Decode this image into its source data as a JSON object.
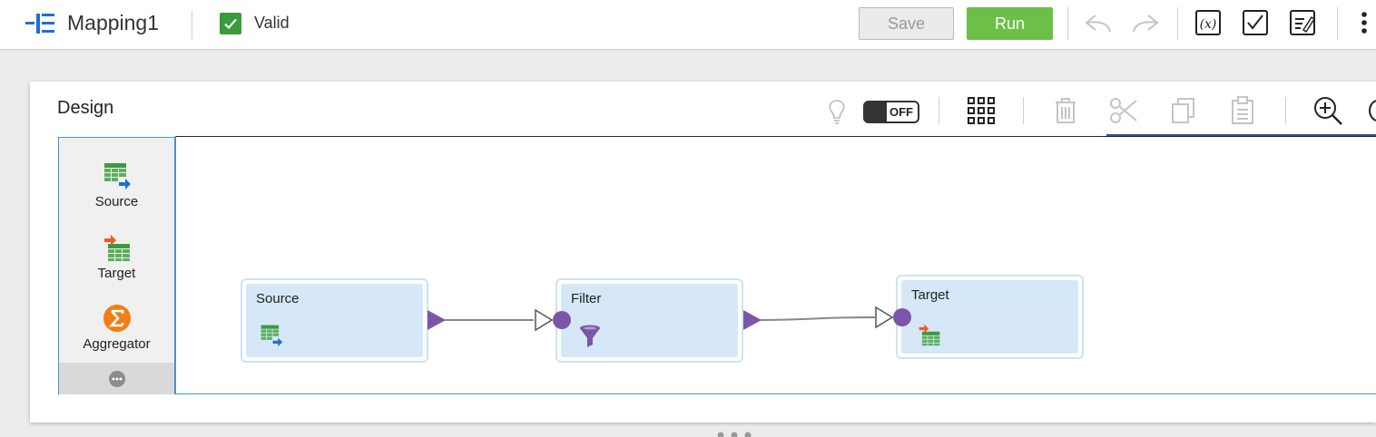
{
  "header": {
    "title": "Mapping1",
    "valid_label": "Valid",
    "save_label": "Save",
    "run_label": "Run",
    "icons": [
      "mapping-icon",
      "valid-checkbox",
      "undo-icon",
      "redo-icon",
      "parameters-icon",
      "validate-icon",
      "notes-icon",
      "more-icon"
    ]
  },
  "design": {
    "title": "Design",
    "toggle_label": "OFF",
    "toolbar_icons": [
      "lightbulb-icon",
      "toggle-switch",
      "grid-icon",
      "delete-icon",
      "cut-icon",
      "copy-icon",
      "paste-icon",
      "zoom-in-icon"
    ]
  },
  "palette": {
    "items": [
      {
        "label": "Source",
        "icon": "source-icon"
      },
      {
        "label": "Target",
        "icon": "target-icon"
      },
      {
        "label": "Aggregator",
        "icon": "aggregator-icon"
      }
    ],
    "more_icon": "more-transformations-icon"
  },
  "canvas": {
    "nodes": [
      {
        "label": "Source",
        "icon": "source-icon"
      },
      {
        "label": "Filter",
        "icon": "filter-icon"
      },
      {
        "label": "Target",
        "icon": "target-icon"
      }
    ],
    "colors": {
      "port": "#7b56a8",
      "node_fill": "#d6e8f7",
      "accent_green": "#6cbf47"
    }
  }
}
